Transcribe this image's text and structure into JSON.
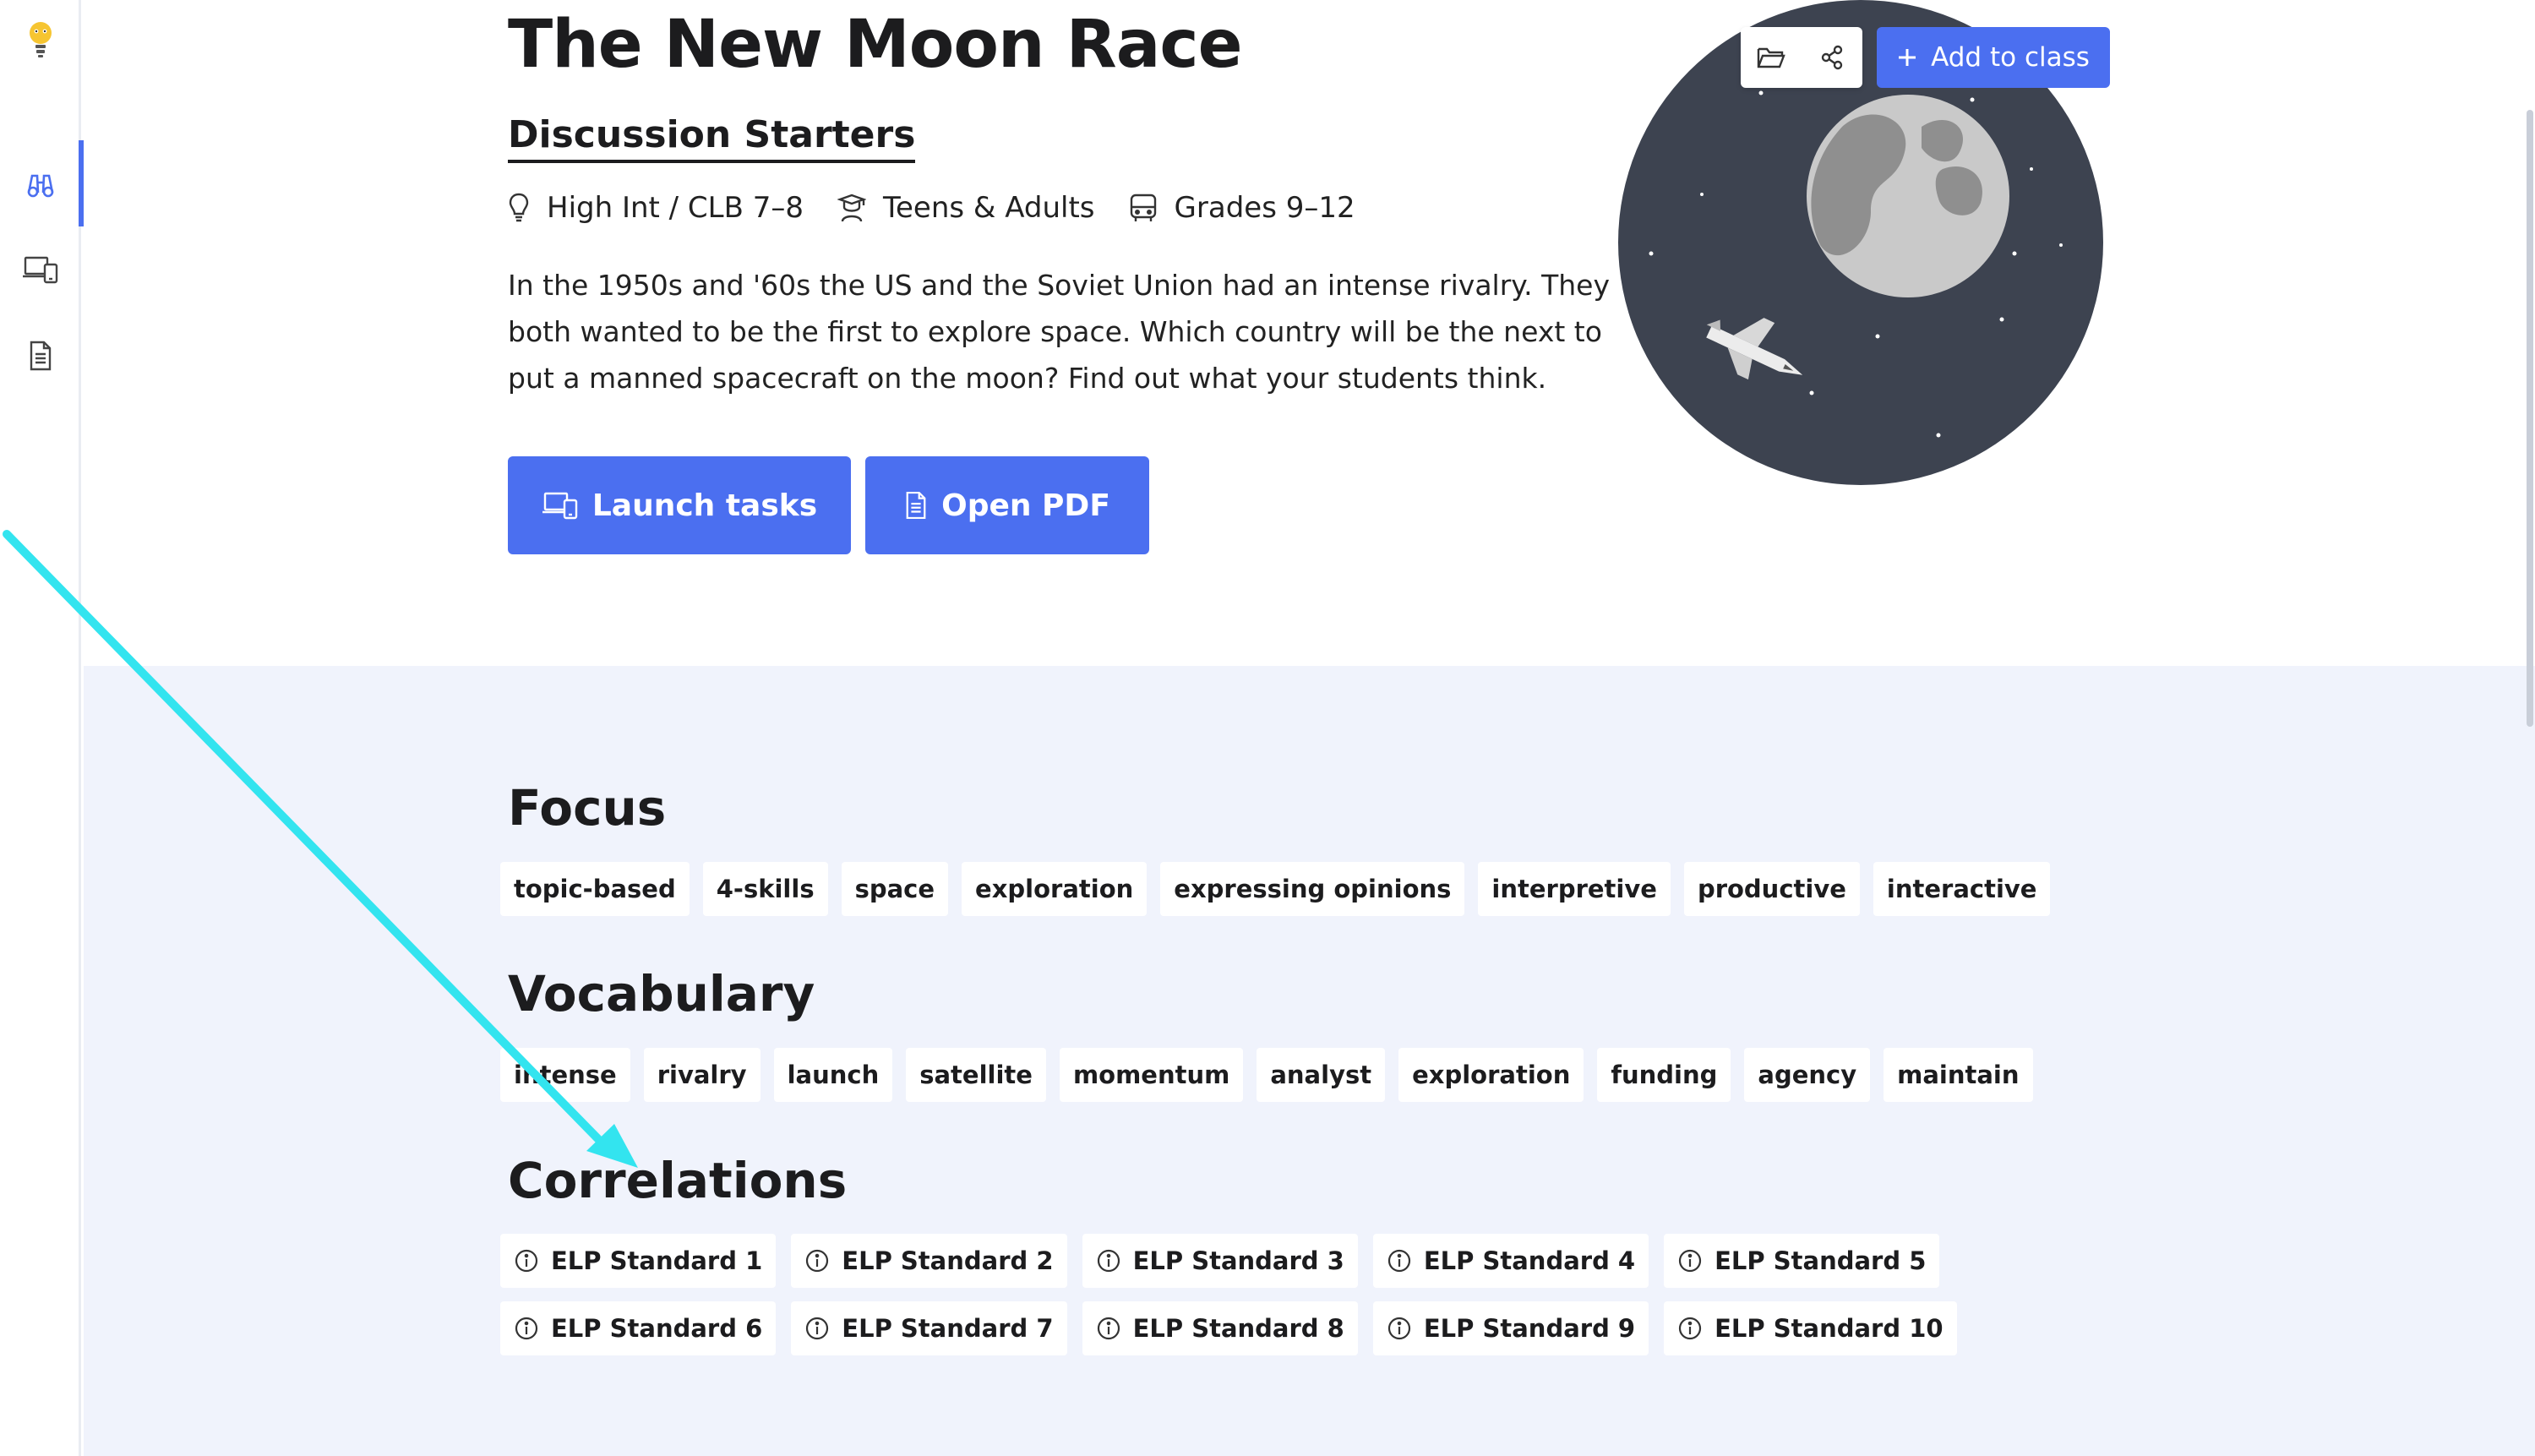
{
  "rail": {
    "items": [
      {
        "name": "discover"
      },
      {
        "name": "tasks"
      },
      {
        "name": "documents"
      }
    ]
  },
  "lesson": {
    "title": "The New Moon Race",
    "type": "Discussion Starters",
    "level": "High Int / CLB 7–8",
    "audience": "Teens & Adults",
    "grades": "Grades 9–12",
    "description": "In the 1950s and '60s the US and the Soviet Union had an intense rivalry. They both wanted to be the first to explore space. Which country will be the next to put a manned spacecraft on the moon? Find out what your students think.",
    "launch_label": "Launch tasks",
    "pdf_label": "Open PDF",
    "add_label": "Add to class"
  },
  "focus": {
    "title": "Focus",
    "tags": [
      "topic-based",
      "4-skills",
      "space",
      "exploration",
      "expressing opinions",
      "interpretive",
      "productive",
      "interactive"
    ]
  },
  "vocabulary": {
    "title": "Vocabulary",
    "tags": [
      "intense",
      "rivalry",
      "launch",
      "satellite",
      "momentum",
      "analyst",
      "exploration",
      "funding",
      "agency",
      "maintain"
    ]
  },
  "correlations": {
    "title": "Correlations",
    "standards": [
      "ELP Standard 1",
      "ELP Standard 2",
      "ELP Standard 3",
      "ELP Standard 4",
      "ELP Standard 5",
      "ELP Standard 6",
      "ELP Standard 7",
      "ELP Standard 8",
      "ELP Standard 9",
      "ELP Standard 10"
    ]
  },
  "colors": {
    "accent": "#4b6ff0",
    "section_bg": "#f0f3fc",
    "illustration_bg": "#3d4350",
    "annotation_arrow": "#33e4ef"
  }
}
